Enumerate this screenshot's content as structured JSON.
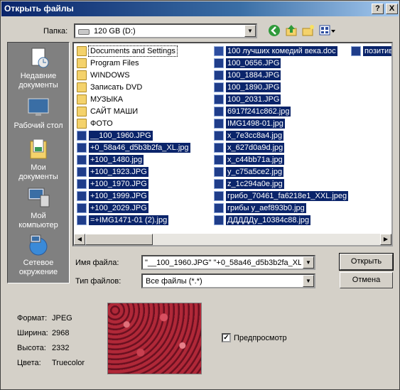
{
  "window": {
    "title": "Открыть файлы",
    "help_btn": "?",
    "close_btn": "X"
  },
  "lookin": {
    "label": "Папка:",
    "value": "120 GB (D:)"
  },
  "places": [
    {
      "label_1": "Недавние",
      "label_2": "документы"
    },
    {
      "label_1": "Рабочий стол",
      "label_2": ""
    },
    {
      "label_1": "Мои",
      "label_2": "документы"
    },
    {
      "label_1": "Мой",
      "label_2": "компьютер"
    },
    {
      "label_1": "Сетевое",
      "label_2": "окружение"
    }
  ],
  "files": {
    "col1": [
      {
        "name": "Documents and Settings"
      },
      {
        "name": "Program Files"
      },
      {
        "name": "WINDOWS"
      },
      {
        "name": "Записать DVD"
      },
      {
        "name": "МУЗЫКА"
      },
      {
        "name": "САЙТ МАШИ"
      },
      {
        "name": "ФОТО"
      },
      {
        "name": "__100_1960.JPG"
      },
      {
        "name": "+0_58a46_d5b3b2fa_XL.jpg"
      },
      {
        "name": "+100_1480.jpg"
      },
      {
        "name": "+100_1923.JPG"
      },
      {
        "name": "+100_1970.JPG"
      },
      {
        "name": "+100_1999.JPG"
      },
      {
        "name": "+100_2029.JPG"
      },
      {
        "name": "=+IMG1471-01 (2).jpg"
      }
    ],
    "col2": [
      {
        "name": "100 лучших комедий века.doc"
      },
      {
        "name": "100_0656.JPG"
      },
      {
        "name": "100_1884.JPG"
      },
      {
        "name": "100_1890.JPG"
      },
      {
        "name": "100_2031.JPG"
      },
      {
        "name": "6917f241c862.jpg"
      },
      {
        "name": "IMG1498-01.jpg"
      },
      {
        "name": "x_7e3cc8a4.jpg"
      },
      {
        "name": "x_627d0a9d.jpg"
      },
      {
        "name": "x_c44bb71a.jpg"
      },
      {
        "name": "y_c75a5ce2.jpg"
      },
      {
        "name": "z_1c294a0e.jpg"
      },
      {
        "name": "грибо_70461_fa6218e1_XXL.jpeg"
      },
      {
        "name": "грибы у_aef893b0.jpg"
      },
      {
        "name": "ДДДДДу_10384c88.jpg"
      }
    ],
    "col3": [
      {
        "name": "позитив"
      }
    ]
  },
  "filename": {
    "label": "Имя файла:",
    "value": "\"__100_1960.JPG\" \"+0_58a46_d5b3b2fa_XL.j"
  },
  "filetype": {
    "label": "Тип файлов:",
    "value": "Все файлы (*.*)"
  },
  "buttons": {
    "open": "Открыть",
    "cancel": "Отмена"
  },
  "info": {
    "format_label": "Формат:",
    "format": "JPEG",
    "width_label": "Ширина:",
    "width": "2968",
    "height_label": "Высота:",
    "height": "2332",
    "color_label": "Цвета:",
    "color": "Truecolor"
  },
  "preview": {
    "label": "Предпросмотр",
    "checked_mark": "✓"
  },
  "colors": {
    "selection": "#0a246a",
    "titlebar": "#0a246a",
    "face": "#d4d0c8"
  }
}
